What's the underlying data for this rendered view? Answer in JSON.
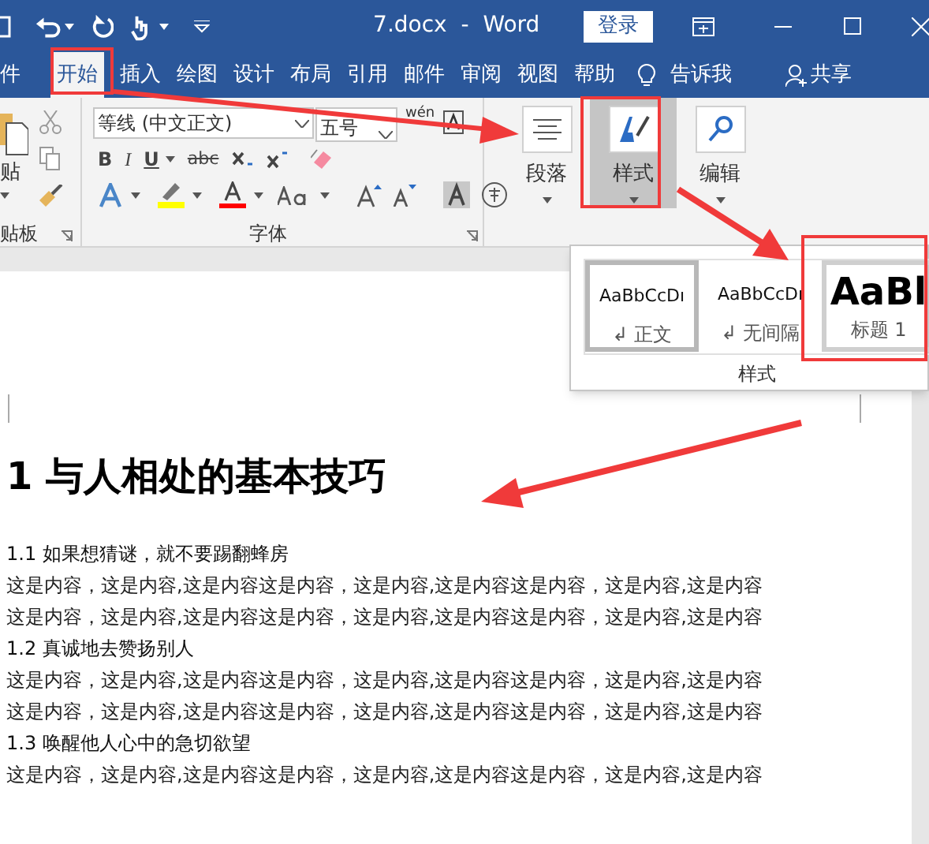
{
  "title_bar": {
    "title": "7.docx  -  Word",
    "login_button": "登录"
  },
  "tabs": [
    {
      "label": "件",
      "selected": false
    },
    {
      "label": "开始",
      "selected": true
    },
    {
      "label": "插入",
      "selected": false
    },
    {
      "label": "绘图",
      "selected": false
    },
    {
      "label": "设计",
      "selected": false
    },
    {
      "label": "布局",
      "selected": false
    },
    {
      "label": "引用",
      "selected": false
    },
    {
      "label": "邮件",
      "selected": false
    },
    {
      "label": "审阅",
      "selected": false
    },
    {
      "label": "视图",
      "selected": false
    },
    {
      "label": "帮助",
      "selected": false
    }
  ],
  "tell_me": "告诉我",
  "share": "共享",
  "ribbon": {
    "clipboard": {
      "paste_label": "贴",
      "group_label": "贴板"
    },
    "font": {
      "format_buttons": [
        {
          "kind": "bold",
          "text": "B"
        },
        {
          "kind": "italic",
          "text": "I"
        },
        {
          "kind": "underline",
          "text": "U"
        },
        {
          "kind": "strike",
          "text": "abc"
        }
      ],
      "font_name": "等线 (中文正文)",
      "font_size": "五号",
      "phonetic": "wén",
      "group_label": "字体"
    },
    "large_buttons": [
      {
        "label": "段落",
        "kind": "paragraph",
        "selected": false
      },
      {
        "label": "样式",
        "kind": "styles",
        "selected": true
      },
      {
        "label": "编辑",
        "kind": "editing",
        "selected": false
      }
    ]
  },
  "styles_gallery": {
    "items": [
      {
        "sample": "AaBbCcDı",
        "name": "正文",
        "return_mark": "↲",
        "kind": "normal",
        "selected": true,
        "framed": true
      },
      {
        "sample": "AaBbCcDı",
        "name": "无间隔",
        "return_mark": "↲",
        "kind": "normal",
        "selected": false,
        "framed": false
      },
      {
        "sample": "AaBl",
        "name": "标题 1",
        "kind": "heading",
        "selected": false,
        "framed": true
      }
    ],
    "group_label": "样式"
  },
  "document": {
    "heading": "1 与人相处的基本技巧",
    "lines": [
      {
        "kind": "subheading",
        "text": "1.1 如果想猜谜，就不要踢翻蜂房"
      },
      {
        "kind": "body",
        "text": "这是内容，这是内容,这是内容这是内容，这是内容,这是内容这是内容，这是内容,这是内容"
      },
      {
        "kind": "body",
        "text": "这是内容，这是内容,这是内容这是内容，这是内容,这是内容这是内容，这是内容,这是内容"
      },
      {
        "kind": "subheading",
        "text": "1.2 真诚地去赞扬别人"
      },
      {
        "kind": "body",
        "text": "这是内容，这是内容,这是内容这是内容，这是内容,这是内容这是内容，这是内容,这是内容"
      },
      {
        "kind": "body",
        "text": "这是内容，这是内容,这是内容这是内容，这是内容,这是内容这是内容，这是内容,这是内容"
      },
      {
        "kind": "subheading",
        "text": "1.3 唤醒他人心中的急切欲望"
      },
      {
        "kind": "body",
        "text": "这是内容，这是内容,这是内容这是内容，这是内容,这是内容这是内容，这是内容,这是内容"
      }
    ]
  }
}
